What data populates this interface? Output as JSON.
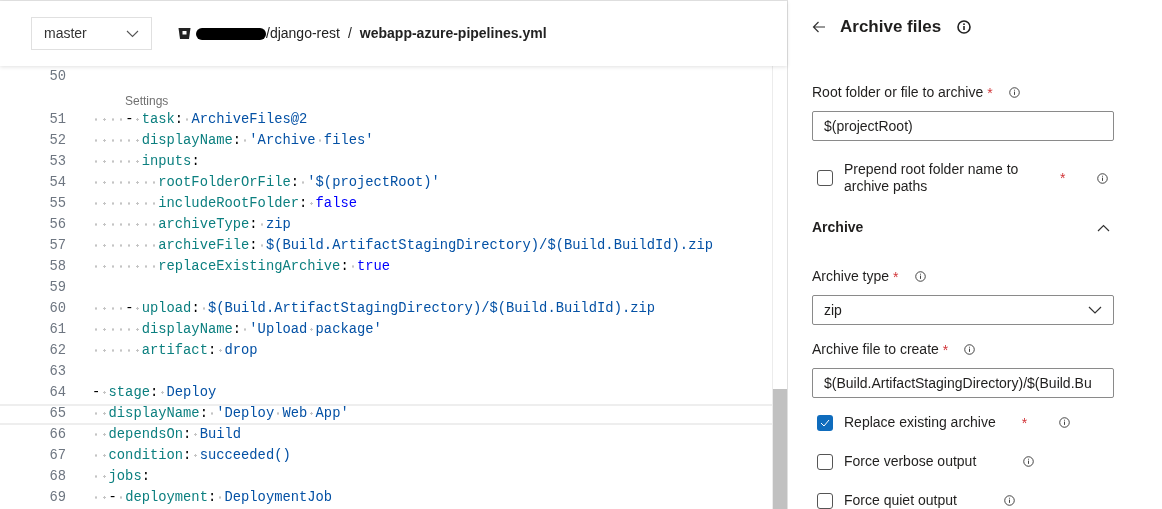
{
  "header": {
    "branch": {
      "value": "master"
    },
    "repo_path": "/django-rest",
    "separator": "/",
    "file_name": "webapp-azure-pipelines.yml"
  },
  "editor": {
    "codelens": "Settings",
    "lines": [
      {
        "number": "50",
        "kind": "plain",
        "highlighted": false
      },
      {
        "number": "51",
        "code": "    - task: ArchiveFiles@2",
        "kind": "plain",
        "highlighted": false
      },
      {
        "number": "52",
        "code": "      displayName: 'Archive files'",
        "kind": "plain",
        "highlighted": false
      },
      {
        "number": "53",
        "code": "      inputs:",
        "kind": "plain",
        "highlighted": false
      },
      {
        "number": "54",
        "code": "        rootFolderOrFile: '$(projectRoot)'",
        "kind": "plain",
        "highlighted": false
      },
      {
        "number": "55",
        "code": "        includeRootFolder: false",
        "kind": "keyword",
        "highlighted": false
      },
      {
        "number": "56",
        "code": "        archiveType: zip",
        "kind": "plain",
        "highlighted": false
      },
      {
        "number": "57",
        "code": "        archiveFile: $(Build.ArtifactStagingDirectory)/$(Build.BuildId).zip",
        "kind": "plain",
        "highlighted": false
      },
      {
        "number": "58",
        "code": "        replaceExistingArchive: true",
        "kind": "keyword",
        "highlighted": false
      },
      {
        "number": "59",
        "kind": "plain",
        "highlighted": false
      },
      {
        "number": "60",
        "code": "    - upload: $(Build.ArtifactStagingDirectory)/$(Build.BuildId).zip",
        "kind": "plain",
        "highlighted": false
      },
      {
        "number": "61",
        "code": "      displayName: 'Upload package'",
        "kind": "plain",
        "highlighted": false
      },
      {
        "number": "62",
        "code": "      artifact: drop",
        "kind": "plain",
        "highlighted": false
      },
      {
        "number": "63",
        "kind": "plain",
        "highlighted": false
      },
      {
        "number": "64",
        "code": "- stage: Deploy",
        "kind": "plain",
        "highlighted": false
      },
      {
        "number": "65",
        "code": "  displayName: 'Deploy Web App'",
        "kind": "plain",
        "highlighted": true
      },
      {
        "number": "66",
        "code": "  dependsOn: Build",
        "kind": "plain",
        "highlighted": false
      },
      {
        "number": "67",
        "code": "  condition: succeeded()",
        "kind": "plain",
        "highlighted": false
      },
      {
        "number": "68",
        "code": "  jobs:",
        "kind": "plain",
        "highlighted": false
      },
      {
        "number": "69",
        "code": "  - deployment: DeploymentJob",
        "kind": "plain",
        "highlighted": false
      }
    ]
  },
  "panel": {
    "title": "Archive files",
    "fields": [
      {
        "kind": "text",
        "label": "Root folder or file to archive",
        "required_mark": "*",
        "value": "$(projectRoot)"
      },
      {
        "kind": "checkbox",
        "label": "Prepend root folder name to archive paths",
        "required_mark": "*",
        "checked": false
      },
      {
        "kind": "section",
        "label": "Archive",
        "expanded": true
      },
      {
        "kind": "select",
        "label": "Archive type",
        "required_mark": "*",
        "value": "zip"
      },
      {
        "kind": "text",
        "label": "Archive file to create",
        "required_mark": "*",
        "value": "$(Build.ArtifactStagingDirectory)/$(Build.Bu"
      },
      {
        "kind": "checkbox",
        "label": "Replace existing archive",
        "required_mark": "*",
        "checked": true
      },
      {
        "kind": "checkbox",
        "label": "Force verbose output",
        "checked": false
      },
      {
        "kind": "checkbox",
        "label": "Force quiet output",
        "checked": false
      }
    ]
  }
}
